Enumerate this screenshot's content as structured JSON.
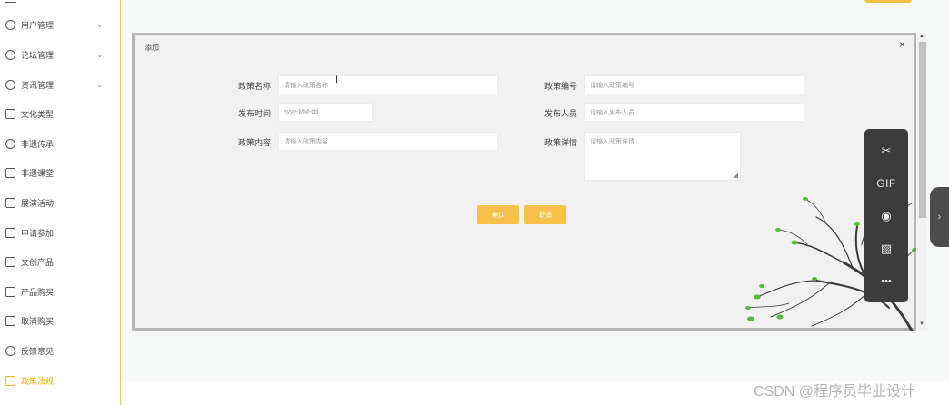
{
  "sidebar": {
    "items": [
      {
        "label": "用户管理",
        "chevron": "⌄",
        "icon": "user-icon"
      },
      {
        "label": "论坛管理",
        "chevron": "⌄",
        "icon": "forum-icon"
      },
      {
        "label": "资讯管理",
        "chevron": "⌄",
        "icon": "gear-icon"
      },
      {
        "label": "文化类型",
        "chevron": "",
        "icon": "bookmark-icon"
      },
      {
        "label": "非遗传承",
        "chevron": "",
        "icon": "heritage-icon"
      },
      {
        "label": "非遗课堂",
        "chevron": "",
        "icon": "classroom-icon"
      },
      {
        "label": "展演活动",
        "chevron": "",
        "icon": "calendar-icon"
      },
      {
        "label": "申请参加",
        "chevron": "",
        "icon": "document-icon"
      },
      {
        "label": "文创产品",
        "chevron": "",
        "icon": "product-icon"
      },
      {
        "label": "产品购买",
        "chevron": "",
        "icon": "bookmark-icon"
      },
      {
        "label": "取消购买",
        "chevron": "",
        "icon": "cancel-icon"
      },
      {
        "label": "反馈意见",
        "chevron": "",
        "icon": "feedback-icon"
      },
      {
        "label": "政策法规",
        "chevron": "",
        "icon": "policy-icon",
        "active": true
      }
    ]
  },
  "dialog": {
    "title": "添加",
    "close": "×",
    "fields": {
      "name": {
        "label": "政策名称",
        "placeholder": "请输入政策名称"
      },
      "number": {
        "label": "政策编号",
        "placeholder": "请输入政策编号"
      },
      "time": {
        "label": "发布时间",
        "placeholder": "yyyy-MM-dd"
      },
      "publisher": {
        "label": "发布人员",
        "placeholder": "请输入发布人员"
      },
      "content": {
        "label": "政策内容",
        "placeholder": "请输入政策内容"
      },
      "detail": {
        "label": "政策详情",
        "placeholder": "请输入政策详情"
      }
    },
    "confirm": "确认",
    "cancel": "取消"
  },
  "toolbar": {
    "scissors": "✂",
    "gif": "GIF",
    "record": "◉",
    "image": "▨",
    "more": "•••",
    "expand": "›"
  },
  "scroll": {
    "up": "▲",
    "down": "▼"
  },
  "watermark": "CSDN @程序员毕业设计",
  "colors": {
    "accent": "#f4b400",
    "button": "#f6c14a",
    "toolbar": "#3c3c3c"
  }
}
